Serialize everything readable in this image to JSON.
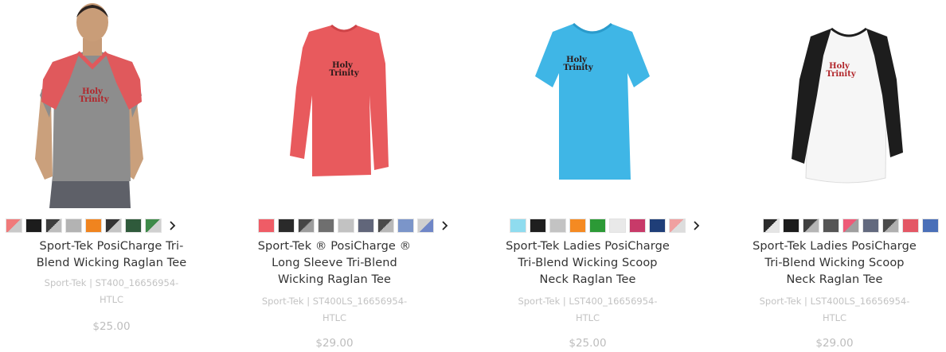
{
  "products": [
    {
      "title_lines": [
        "Sport-Tek PosiCharge Tri-",
        "Blend Wicking Raglan Tee"
      ],
      "sku_lines": [
        "Sport-Tek | ST400_16656954-",
        "HTLC"
      ],
      "price": "$25.00",
      "swatches": [
        "#f07a7a|#c9c9c9",
        "#1c1c1c",
        "#3d3d3d|#bdbdbd",
        "#b3b3b3",
        "#f0841f",
        "#333333|#c4c4c4",
        "#2f5a3b",
        "#3e8a49|#d0d0d0"
      ],
      "image": "model-red-gray-raglan-tee"
    },
    {
      "title_lines": [
        "Sport-Tek ® PosiCharge ®",
        "Long Sleeve Tri-Blend",
        "Wicking Raglan Tee"
      ],
      "sku_lines": [
        "Sport-Tek | ST400LS_16656954-",
        "HTLC"
      ],
      "price": "$29.00",
      "swatches": [
        "#ef5c66",
        "#2a2a2a",
        "#454545|#9d9d9d",
        "#6f6f6f",
        "#c2c2c2",
        "#61667a",
        "#4b4b4b|#b8b8b8",
        "#7b95c9",
        "#cfcfcf|#6f86c7"
      ],
      "image": "red-long-sleeve-tee"
    },
    {
      "title_lines": [
        "Sport-Tek Ladies PosiCharge",
        "Tri-Blend Wicking Scoop",
        "Neck Raglan Tee"
      ],
      "sku_lines": [
        "Sport-Tek | LST400_16656954-",
        "HTLC"
      ],
      "price": "$25.00",
      "swatches": [
        "#8fdcef",
        "#1f1f1f",
        "#c3c3c3",
        "#f58a22",
        "#2c9a36",
        "#e9e9e9",
        "#c83a69",
        "#1f3e78",
        "#f0a0a0|#dddddd"
      ],
      "image": "blue-scoop-neck-tee"
    },
    {
      "title_lines": [
        "Sport-Tek Ladies PosiCharge",
        "Tri-Blend Wicking Scoop",
        "Neck Raglan Tee"
      ],
      "sku_lines": [
        "Sport-Tek | LST400LS_16656954-",
        "HTLC"
      ],
      "price": "$29.00",
      "swatches": [
        "#2b2b2b|#e5e5e5",
        "#1c1c1c",
        "#3f3f3f|#b5b5b5",
        "#555555",
        "#ee5a77|#9f9f9f",
        "#62697e",
        "#4a4a4a|#b0b0b0",
        "#e45765",
        "#4a6fb8"
      ],
      "image": "black-white-long-sleeve-raglan"
    }
  ],
  "logo_text": [
    "Holy",
    "Trinity"
  ],
  "next_arrow": "›"
}
